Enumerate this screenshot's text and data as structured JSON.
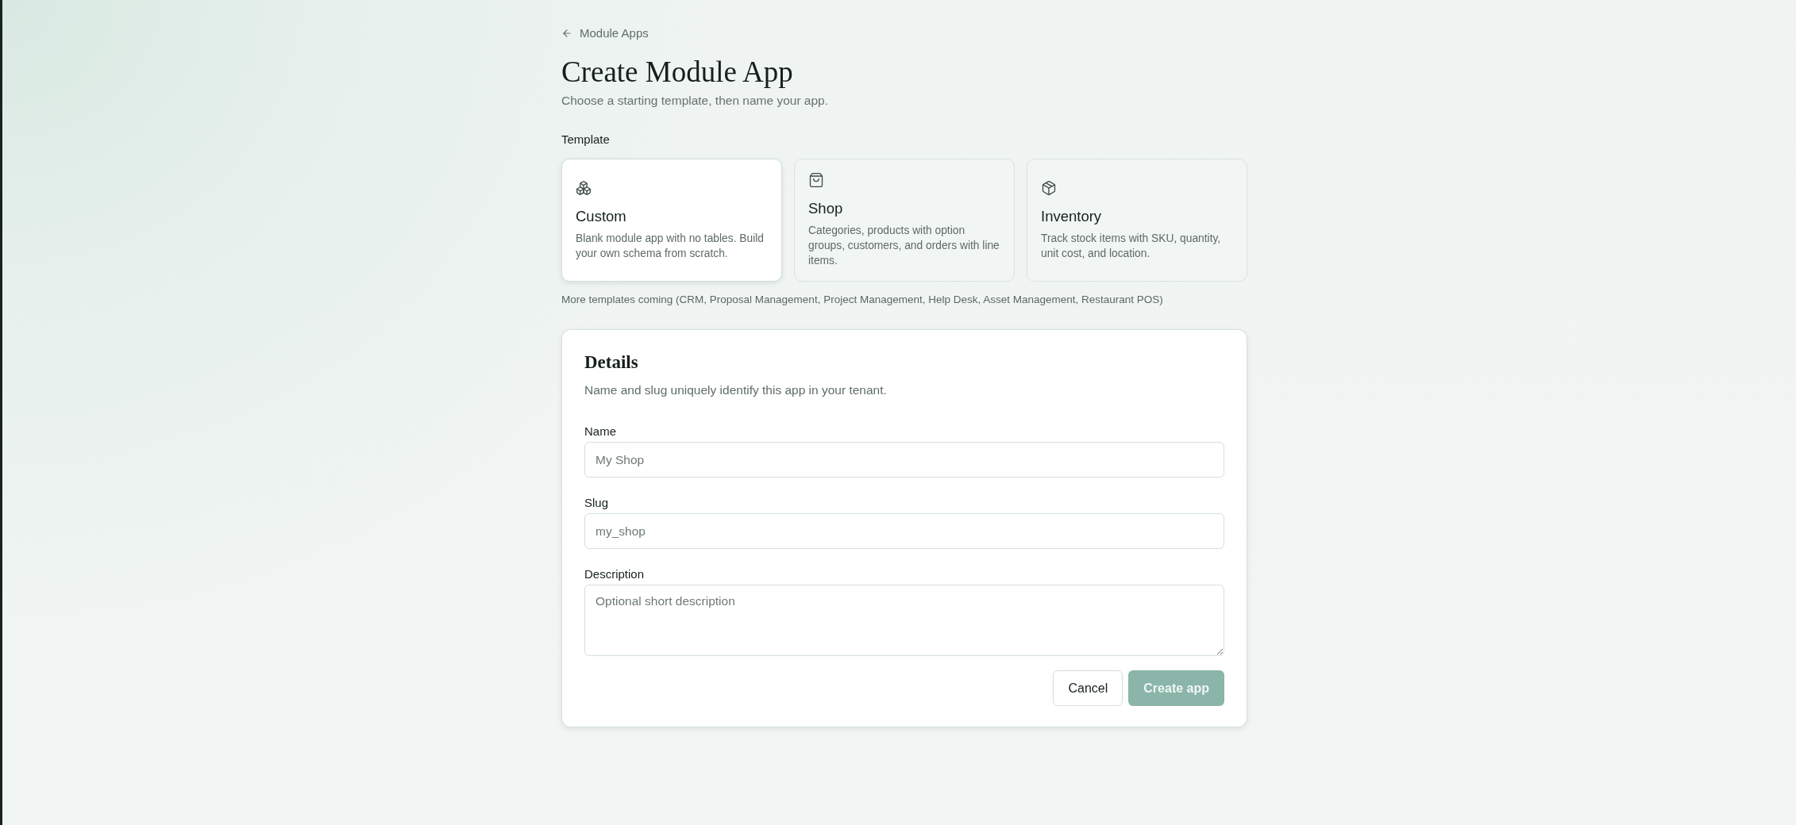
{
  "back_link": {
    "label": "Module Apps"
  },
  "header": {
    "title": "Create Module App",
    "subtitle": "Choose a starting template, then name your app."
  },
  "template": {
    "label": "Template",
    "cards": [
      {
        "title": "Custom",
        "description": "Blank module app with no tables. Build your own schema from scratch.",
        "selected": true
      },
      {
        "title": "Shop",
        "description": "Categories, products with option groups, customers, and orders with line items.",
        "selected": false
      },
      {
        "title": "Inventory",
        "description": "Track stock items with SKU, quantity, unit cost, and location.",
        "selected": false
      }
    ],
    "note": "More templates coming (CRM, Proposal Management, Project Management, Help Desk, Asset Management, Restaurant POS)"
  },
  "details": {
    "title": "Details",
    "description": "Name and slug uniquely identify this app in your tenant.",
    "fields": [
      {
        "label": "Name",
        "placeholder": "My Shop",
        "kind": "input"
      },
      {
        "label": "Slug",
        "placeholder": "my_shop",
        "kind": "input"
      },
      {
        "label": "Description",
        "placeholder": "Optional short description",
        "kind": "textarea"
      }
    ],
    "buttons": [
      {
        "label": "Cancel",
        "kind": "secondary",
        "disabled": false
      },
      {
        "label": "Create app",
        "kind": "primary",
        "disabled": true
      }
    ]
  }
}
